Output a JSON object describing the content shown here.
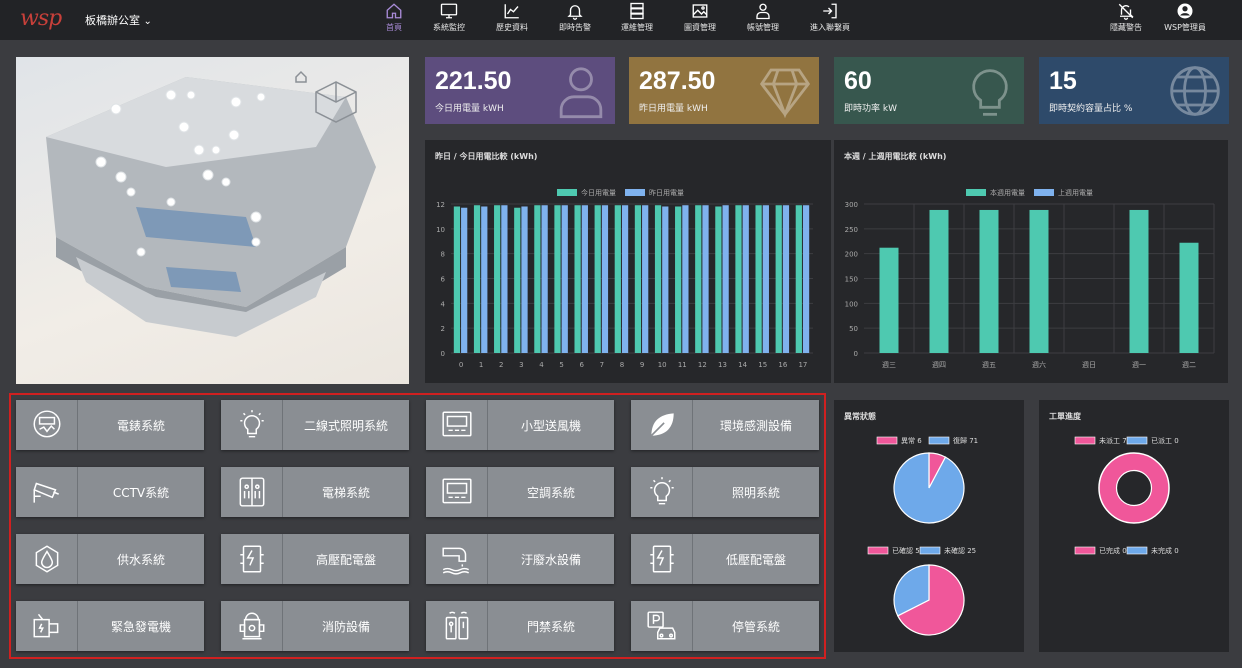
{
  "app": {
    "logo": "wsp",
    "site": "板橋辦公室",
    "site_chevron": "⌄"
  },
  "nav": [
    {
      "label": "首頁",
      "icon": "home-icon",
      "active": true
    },
    {
      "label": "系統監控",
      "icon": "monitor-icon"
    },
    {
      "label": "歷史資料",
      "icon": "line-chart-icon"
    },
    {
      "label": "即時告警",
      "icon": "bell-icon"
    },
    {
      "label": "運維管理",
      "icon": "server-icon"
    },
    {
      "label": "圖資管理",
      "icon": "image-icon"
    },
    {
      "label": "帳號管理",
      "icon": "user-icon"
    },
    {
      "label": "進入聯繫頁",
      "icon": "enter-icon"
    }
  ],
  "right_nav": [
    {
      "label": "隱藏警告",
      "icon": "bell-off-icon"
    },
    {
      "label": "WSP管理員",
      "icon": "account-icon"
    }
  ],
  "kpis": [
    {
      "value": "221.50",
      "caption": "今日用電量 kWH",
      "color": "#5d4d7e",
      "icon": "user-icon"
    },
    {
      "value": "287.50",
      "caption": "昨日用電量 kWH",
      "color": "#917440",
      "icon": "diamond-icon"
    },
    {
      "value": "60",
      "caption": "即時功率 kW",
      "color": "#37574e",
      "icon": "bulb-icon"
    },
    {
      "value": "15",
      "caption": "即時契約容量占比 %",
      "color": "#2e4a6a",
      "icon": "globe-icon"
    }
  ],
  "chart_data": [
    {
      "type": "bar",
      "title": "昨日 / 今日用電比較 (kWh)",
      "categories": [
        "0",
        "1",
        "2",
        "3",
        "4",
        "5",
        "6",
        "7",
        "8",
        "9",
        "10",
        "11",
        "12",
        "13",
        "14",
        "15",
        "16",
        "17"
      ],
      "series": [
        {
          "name": "今日用電量",
          "color": "#4ec9b0",
          "values": [
            11.8,
            11.9,
            11.9,
            11.7,
            11.9,
            11.9,
            11.9,
            11.9,
            11.9,
            11.9,
            11.9,
            11.8,
            11.9,
            11.8,
            11.9,
            11.9,
            11.9,
            11.9
          ]
        },
        {
          "name": "昨日用電量",
          "color": "#7fb2ee",
          "values": [
            11.7,
            11.8,
            11.9,
            11.8,
            11.9,
            11.9,
            11.9,
            11.9,
            11.9,
            11.9,
            11.8,
            11.9,
            11.9,
            11.9,
            11.9,
            11.9,
            11.9,
            11.9
          ]
        }
      ],
      "ylim": [
        0,
        12
      ],
      "yticks": [
        0,
        2,
        4,
        6,
        8,
        10,
        12
      ],
      "grid": true,
      "legend": "top"
    },
    {
      "type": "bar",
      "title": "本週 / 上週用電比較 (kWh)",
      "categories": [
        "週三",
        "週四",
        "週五",
        "週六",
        "週日",
        "週一",
        "週二"
      ],
      "series": [
        {
          "name": "本週用電量",
          "color": "#4ec9b0",
          "values": [
            212,
            288,
            288,
            288,
            0,
            288,
            222
          ]
        },
        {
          "name": "上週用電量",
          "color": "#7fb2ee",
          "values": [
            0,
            0,
            0,
            0,
            0,
            0,
            0
          ]
        }
      ],
      "ylim": [
        0,
        300
      ],
      "yticks": [
        0,
        50,
        100,
        150,
        200,
        250,
        300
      ],
      "grid": true,
      "legend": "top"
    },
    {
      "type": "pie",
      "title": "異常狀態",
      "groups": [
        {
          "slices": [
            {
              "name": "異常",
              "value": 6,
              "label": "異常 6",
              "color": "#f0579a"
            },
            {
              "name": "復歸",
              "value": 71,
              "label": "復歸 71",
              "color": "#6ea9ea"
            }
          ]
        },
        {
          "slices": [
            {
              "name": "已確認",
              "value": 52,
              "label": "已確認 52",
              "color": "#f0579a"
            },
            {
              "name": "未確認",
              "value": 25,
              "label": "未確認 25",
              "color": "#6ea9ea"
            }
          ]
        }
      ]
    },
    {
      "type": "pie",
      "title": "工單進度",
      "groups": [
        {
          "donut": true,
          "slices": [
            {
              "name": "未派工",
              "value": 77,
              "label": "未派工 77",
              "color": "#f0579a"
            },
            {
              "name": "已派工",
              "value": 0,
              "label": "已派工 0",
              "color": "#6ea9ea"
            }
          ]
        },
        {
          "slices": [
            {
              "name": "已完成",
              "value": 0,
              "label": "已完成 0",
              "color": "#f0579a"
            },
            {
              "name": "未完成",
              "value": 0,
              "label": "未完成 0",
              "color": "#6ea9ea"
            }
          ]
        }
      ]
    }
  ],
  "systems": [
    {
      "label": "電錶系統",
      "icon": "meter-icon"
    },
    {
      "label": "二線式照明系統",
      "icon": "bulb-icon"
    },
    {
      "label": "小型送風機",
      "icon": "thermostat-icon"
    },
    {
      "label": "環境感測設備",
      "icon": "leaf-icon"
    },
    {
      "label": "CCTV系統",
      "icon": "cctv-icon"
    },
    {
      "label": "電梯系統",
      "icon": "elevator-icon"
    },
    {
      "label": "空調系統",
      "icon": "thermostat-icon"
    },
    {
      "label": "照明系統",
      "icon": "bulb-icon"
    },
    {
      "label": "供水系統",
      "icon": "water-drop-icon"
    },
    {
      "label": "高壓配電盤",
      "icon": "panel-icon"
    },
    {
      "label": "汙廢水設備",
      "icon": "pipe-icon"
    },
    {
      "label": "低壓配電盤",
      "icon": "panel-icon"
    },
    {
      "label": "緊急發電機",
      "icon": "generator-icon"
    },
    {
      "label": "消防設備",
      "icon": "hydrant-icon"
    },
    {
      "label": "門禁系統",
      "icon": "door-lock-icon"
    },
    {
      "label": "停管系統",
      "icon": "parking-icon"
    }
  ]
}
